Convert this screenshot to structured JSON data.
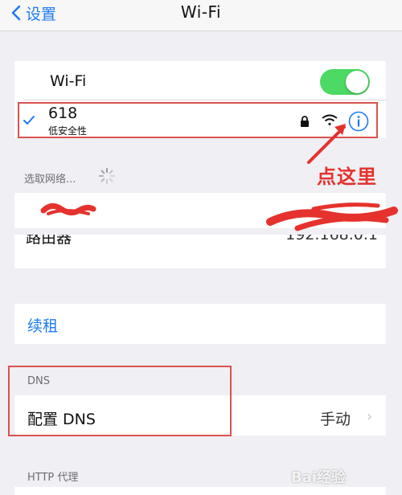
{
  "nav": {
    "back_label": "设置",
    "title": "Wi-Fi"
  },
  "wifi": {
    "label": "Wi-Fi",
    "enabled": true
  },
  "connected": {
    "ssid": "618",
    "security": "低安全性"
  },
  "select_network_label": "选取网络...",
  "router_label": "路由器",
  "router_value": "192.168.0.1",
  "renew_label": "续租",
  "dns": {
    "header": "DNS",
    "configure_label": "配置 DNS",
    "configure_value": "手动"
  },
  "http_proxy_header": "HTTP 代理",
  "annotation": {
    "text": "点这里",
    "color": "#e5322d"
  },
  "watermark": "Bai经验",
  "colors": {
    "accent": "#1d7bf0",
    "switch_on": "#4cd964",
    "highlight": "#d9534f"
  }
}
